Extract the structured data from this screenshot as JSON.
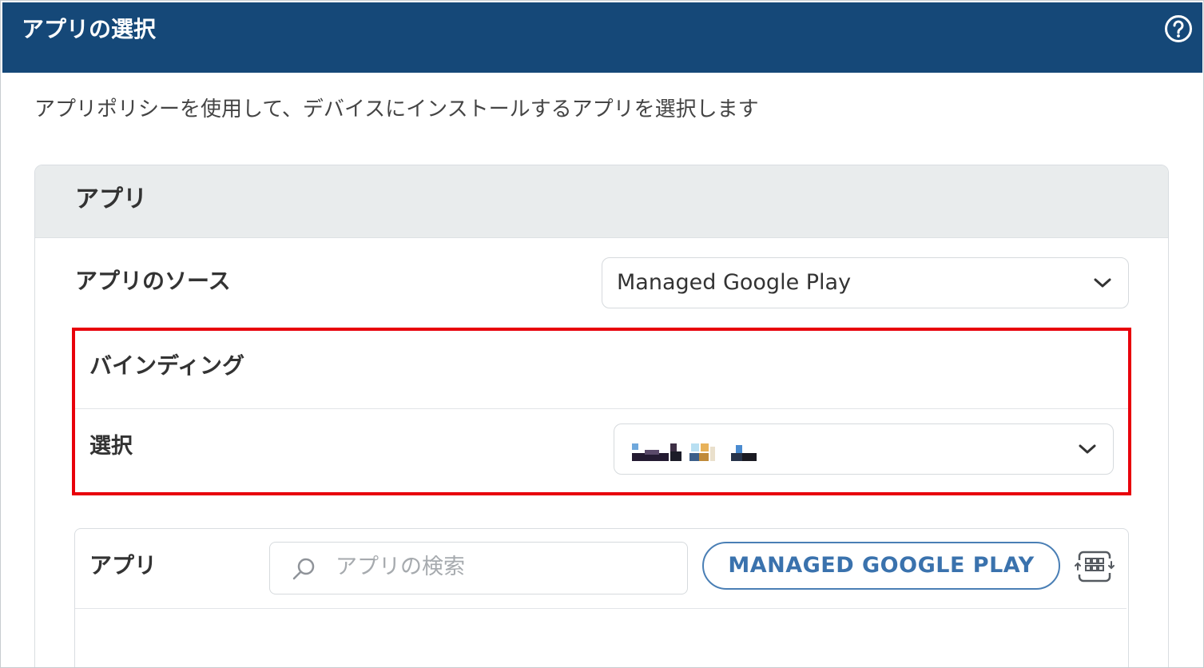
{
  "header": {
    "title": "アプリの選択",
    "help_icon": "question-circle-icon",
    "background_color": "#154878"
  },
  "description": "アプリポリシーを使用して、デバイスにインストールするアプリを選択します",
  "card": {
    "title": "アプリ",
    "app_source": {
      "label": "アプリのソース",
      "value": "Managed Google Play"
    },
    "binding": {
      "section_title": "バインディング",
      "select_label": "選択",
      "select_value_note": "pixelated / redacted value",
      "highlight_color": "#e8000b"
    },
    "apps": {
      "label": "アプリ",
      "search_placeholder": "アプリの検索",
      "search_icon": "search-icon",
      "button_label": "MANAGED GOOGLE PLAY",
      "apps_icon": "app-grid-sync-icon"
    }
  }
}
